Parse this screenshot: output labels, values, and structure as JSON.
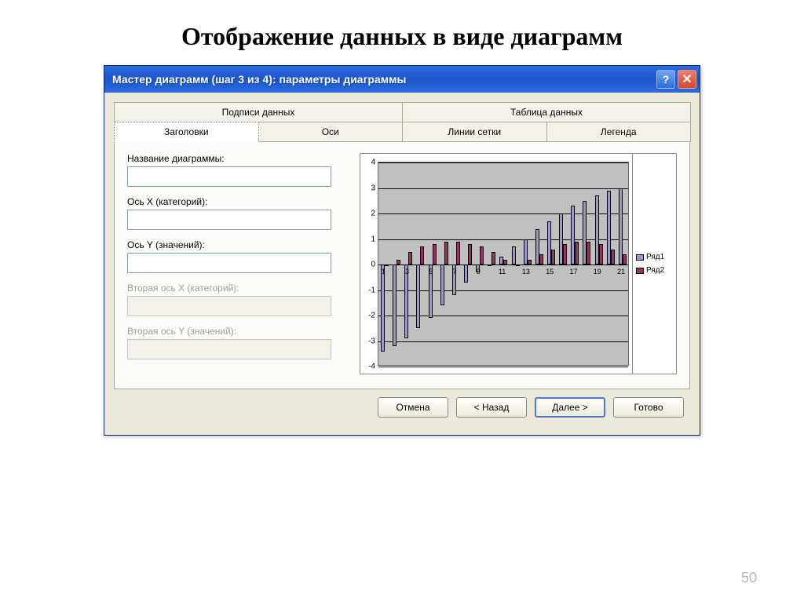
{
  "slide": {
    "title": "Отображение данных в виде диаграмм",
    "page_number": "50"
  },
  "dialog": {
    "title": "Мастер диаграмм (шаг 3 из 4): параметры диаграммы",
    "tabs_top": [
      {
        "label": "Подписи данных"
      },
      {
        "label": "Таблица данных"
      }
    ],
    "tabs_bottom": [
      {
        "label": "Заголовки",
        "active": true
      },
      {
        "label": "Оси"
      },
      {
        "label": "Линии сетки"
      },
      {
        "label": "Легенда"
      }
    ],
    "fields": {
      "chart_title_label": "Название диаграммы:",
      "x_axis_label": "Ось X (категорий):",
      "y_axis_label": "Ось Y (значений):",
      "x2_axis_label": "Вторая ось X (категорий):",
      "y2_axis_label": "Вторая ось Y (значений):"
    },
    "buttons": {
      "cancel": "Отмена",
      "back": "< Назад",
      "next": "Далее >",
      "finish": "Готово"
    },
    "legend": {
      "s1": "Ряд1",
      "s2": "Ряд2"
    }
  },
  "chart_data": {
    "type": "bar",
    "ylim": [
      -4,
      4
    ],
    "yticks": [
      -4,
      -3,
      -2,
      -1,
      0,
      1,
      2,
      3,
      4
    ],
    "categories": [
      1,
      2,
      3,
      4,
      5,
      6,
      7,
      8,
      9,
      10,
      11,
      12,
      13,
      14,
      15,
      16,
      17,
      18,
      19,
      20,
      21
    ],
    "xlabels_shown": [
      1,
      3,
      5,
      7,
      9,
      11,
      13,
      15,
      17,
      19,
      21
    ],
    "series": [
      {
        "name": "Ряд1",
        "values": [
          -3.4,
          -3.2,
          -2.9,
          -2.5,
          -2.1,
          -1.6,
          -1.2,
          -0.7,
          -0.3,
          0.0,
          0.3,
          0.7,
          1.0,
          1.4,
          1.7,
          2.0,
          2.3,
          2.5,
          2.7,
          2.9,
          3.0
        ]
      },
      {
        "name": "Ряд2",
        "values": [
          0.0,
          0.2,
          0.5,
          0.7,
          0.8,
          0.9,
          0.9,
          0.8,
          0.7,
          0.5,
          0.2,
          0.0,
          0.2,
          0.4,
          0.6,
          0.8,
          0.9,
          0.9,
          0.8,
          0.6,
          0.4
        ]
      }
    ]
  }
}
